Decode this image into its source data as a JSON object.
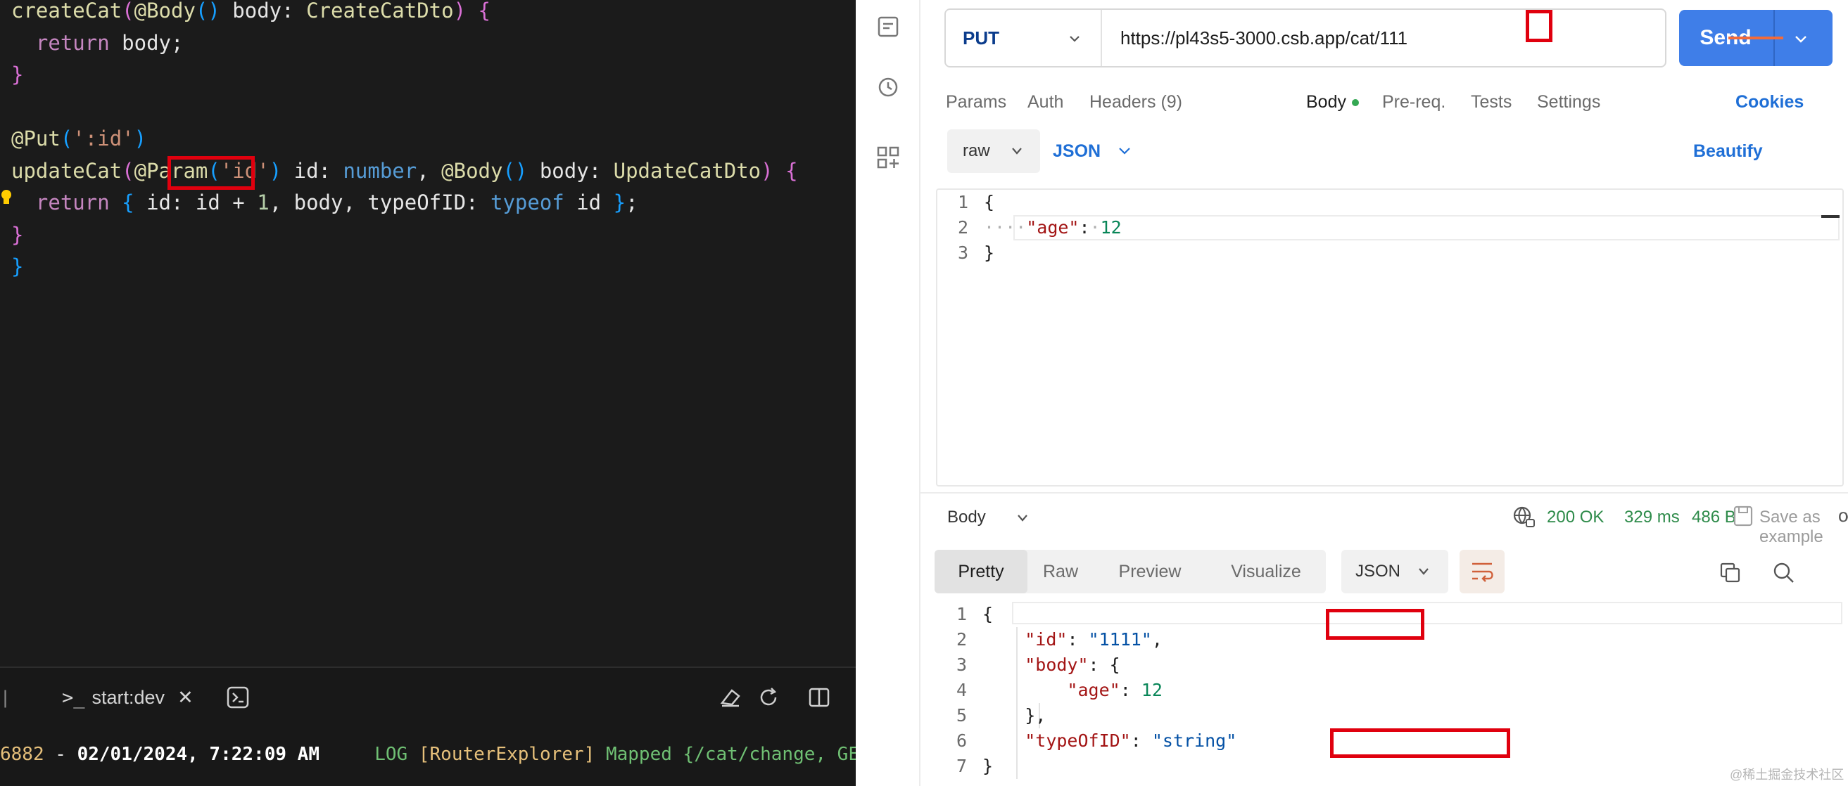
{
  "editor": {
    "lines": [
      {
        "parts": [
          [
            "c-fn",
            "createCat"
          ],
          [
            "c-paren",
            "("
          ],
          [
            "c-dec",
            "@Body"
          ],
          [
            "c-paren2",
            "()"
          ],
          [
            "c-ident",
            " body: "
          ],
          [
            "c-type",
            "CreateCatDto"
          ],
          [
            "c-paren",
            ")"
          ],
          [
            "c-plain",
            " "
          ],
          [
            "c-paren",
            "{"
          ]
        ]
      },
      {
        "parts": [
          [
            "c-plain",
            "  "
          ],
          [
            "c-kw2",
            "return"
          ],
          [
            "c-ident",
            " body;"
          ]
        ]
      },
      {
        "parts": [
          [
            "c-paren",
            "}"
          ]
        ]
      },
      {
        "parts": []
      },
      {
        "parts": [
          [
            "c-dec",
            "@Put"
          ],
          [
            "c-paren2",
            "("
          ],
          [
            "c-str",
            "':id'"
          ],
          [
            "c-paren2",
            ")"
          ]
        ]
      },
      {
        "parts": [
          [
            "c-fn",
            "updateCat"
          ],
          [
            "c-paren",
            "("
          ],
          [
            "c-dec",
            "@Param"
          ],
          [
            "c-paren2",
            "("
          ],
          [
            "c-str",
            "'id'"
          ],
          [
            "c-paren2",
            ")"
          ],
          [
            "c-ident",
            " id: "
          ],
          [
            "c-kw",
            "number"
          ],
          [
            "c-ident",
            ", "
          ],
          [
            "c-dec",
            "@Body"
          ],
          [
            "c-paren2",
            "()"
          ],
          [
            "c-ident",
            " body: "
          ],
          [
            "c-type",
            "UpdateCatDto"
          ],
          [
            "c-paren",
            ")"
          ],
          [
            "c-plain",
            " "
          ],
          [
            "c-paren",
            "{"
          ]
        ]
      },
      {
        "parts": [
          [
            "c-plain",
            "  "
          ],
          [
            "c-kw2",
            "return"
          ],
          [
            "c-plain",
            " "
          ],
          [
            "c-paren2",
            "{"
          ],
          [
            "c-ident",
            " id: id + "
          ],
          [
            "c-num",
            "1"
          ],
          [
            "c-ident",
            ", body, typeOfID: "
          ],
          [
            "c-kw",
            "typeof"
          ],
          [
            "c-ident",
            " id "
          ],
          [
            "c-paren2",
            "}"
          ],
          [
            "c-ident",
            ";"
          ]
        ]
      },
      {
        "parts": [
          [
            "c-paren",
            "}"
          ]
        ]
      },
      {
        "parts": [
          [
            "c-paren2",
            "}"
          ]
        ]
      }
    ],
    "terminal": {
      "tab_label": "start:dev",
      "log_prefix": "6882",
      "log_dash": " - ",
      "log_time": "02/01/2024, 7:22:09 AM",
      "log_level": "     LOG ",
      "log_source": "[RouterExplorer]",
      "log_message": " Mapped {/cat/change, GET}"
    }
  },
  "request": {
    "method": "PUT",
    "url": "https://pl43s5-3000.csb.app/cat/111",
    "send_label": "Send",
    "tabs": [
      {
        "label": "Params"
      },
      {
        "label": "Auth"
      },
      {
        "label": "Headers (9)"
      },
      {
        "label": "Body"
      },
      {
        "label": "Pre-req."
      },
      {
        "label": "Tests"
      },
      {
        "label": "Settings"
      }
    ],
    "cookies_label": "Cookies",
    "body_mode": "raw",
    "body_format": "JSON",
    "beautify_label": "Beautify",
    "body_lines": [
      {
        "num": "1",
        "parts": [
          [
            "",
            "{"
          ]
        ]
      },
      {
        "num": "2",
        "parts": [
          [
            "j-ws",
            "····"
          ],
          [
            "j-key",
            "\"age\""
          ],
          [
            "",
            ":"
          ],
          [
            "j-ws",
            "·"
          ],
          [
            "j-num",
            "12"
          ]
        ]
      },
      {
        "num": "3",
        "parts": [
          [
            "",
            "}"
          ]
        ]
      }
    ]
  },
  "response": {
    "section_label": "Body",
    "status": "200 OK",
    "time": "329 ms",
    "size": "486 B",
    "save_label": "Save as example",
    "more_label": "ooo",
    "view_tabs": [
      {
        "label": "Pretty"
      },
      {
        "label": "Raw"
      },
      {
        "label": "Preview"
      },
      {
        "label": "Visualize"
      }
    ],
    "format": "JSON",
    "lines": [
      {
        "num": "1",
        "parts": [
          [
            "",
            "{"
          ]
        ]
      },
      {
        "num": "2",
        "parts": [
          [
            "",
            "    "
          ],
          [
            "j-key",
            "\"id\""
          ],
          [
            "",
            ": "
          ],
          [
            "j-str",
            "\"1111\""
          ],
          [
            "",
            ","
          ]
        ]
      },
      {
        "num": "3",
        "parts": [
          [
            "",
            "    "
          ],
          [
            "j-key",
            "\"body\""
          ],
          [
            "",
            ": {"
          ]
        ]
      },
      {
        "num": "4",
        "parts": [
          [
            "",
            "        "
          ],
          [
            "j-key",
            "\"age\""
          ],
          [
            "",
            ": "
          ],
          [
            "j-num",
            "12"
          ]
        ]
      },
      {
        "num": "5",
        "parts": [
          [
            "",
            "    },"
          ]
        ]
      },
      {
        "num": "6",
        "parts": [
          [
            "",
            "    "
          ],
          [
            "j-key",
            "\"typeOfID\""
          ],
          [
            "",
            ": "
          ],
          [
            "j-str",
            "\"string\""
          ]
        ]
      },
      {
        "num": "7",
        "parts": [
          [
            "",
            "}"
          ]
        ]
      }
    ]
  },
  "watermark": "@稀土掘金技术社区",
  "colors": {
    "accent": "#3f7ee8",
    "highlight": "#e0000e",
    "status_ok": "#2e8b4a"
  }
}
